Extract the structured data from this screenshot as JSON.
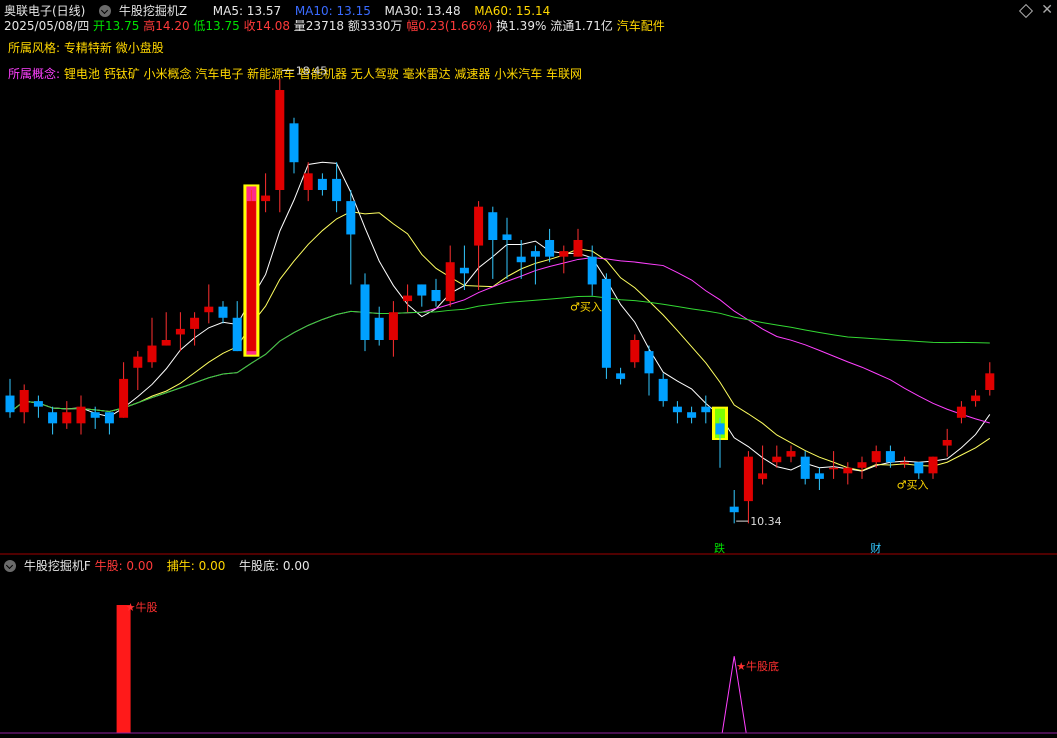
{
  "header": {
    "stock": "奥联电子(日线)",
    "indicator_main": "牛股挖掘机Z",
    "ma5": "MA5: 13.57",
    "ma10": "MA10: 13.15",
    "ma30": "MA30: 13.48",
    "ma60": "MA60: 15.14",
    "date": "2025/05/08/四",
    "open": "开13.75",
    "high": "高14.20",
    "low": "低13.75",
    "close": "收14.08",
    "volume": "量23718",
    "amount": "额3330万",
    "change": "幅0.23(1.66%)",
    "turnover": "换1.39%",
    "float": "流通1.71亿",
    "sector": "汽车配件"
  },
  "style": {
    "label": "所属风格:",
    "value": "专精特新 微小盘股"
  },
  "concept": {
    "label": "所属概念:",
    "value": "锂电池 钙钛矿 小米概念 汽车电子 新能源车 智能机器 无人驾驶 毫米雷达 减速器 小米汽车 车联网"
  },
  "sub_header": {
    "title": "牛股挖掘机F",
    "niugu": "牛股: 0.00",
    "boniu": "捕牛: 0.00",
    "niugudi": "牛股底: 0.00"
  },
  "colors": {
    "up": "#e00000",
    "down": "#00a0ff",
    "ma5": "#ffffff",
    "ma10": "#ffff60",
    "ma30": "#ff40ff",
    "ma60": "#33d833"
  },
  "chart_data": [
    {
      "type": "candlestick",
      "title": "奥联电子(日线)",
      "ylim": [
        10.0,
        19.0
      ],
      "candles": [
        [
          12.6,
          12.3,
          12.9,
          12.2
        ],
        [
          12.3,
          12.7,
          12.8,
          12.1
        ],
        [
          12.5,
          12.4,
          12.6,
          12.2
        ],
        [
          12.3,
          12.1,
          12.4,
          11.9
        ],
        [
          12.1,
          12.3,
          12.5,
          12.0
        ],
        [
          12.1,
          12.4,
          12.6,
          11.9
        ],
        [
          12.3,
          12.2,
          12.4,
          12.0
        ],
        [
          12.3,
          12.1,
          12.3,
          11.9
        ],
        [
          12.2,
          12.9,
          13.2,
          12.2
        ],
        [
          13.1,
          13.3,
          13.4,
          12.7
        ],
        [
          13.2,
          13.5,
          14.0,
          13.1
        ],
        [
          13.5,
          13.6,
          14.1,
          13.5
        ],
        [
          13.7,
          13.8,
          14.1,
          13.4
        ],
        [
          13.8,
          14.0,
          14.1,
          13.5
        ],
        [
          14.1,
          14.2,
          14.6,
          13.9
        ],
        [
          14.2,
          14.0,
          14.3,
          13.9
        ],
        [
          14.0,
          13.4,
          14.3,
          13.4
        ],
        [
          13.4,
          16.1,
          16.3,
          13.4
        ],
        [
          16.1,
          16.2,
          16.6,
          15.9
        ],
        [
          16.3,
          18.1,
          18.3,
          15.9
        ],
        [
          17.5,
          16.8,
          17.6,
          16.6
        ],
        [
          16.3,
          16.6,
          16.8,
          16.1
        ],
        [
          16.5,
          16.3,
          16.6,
          16.2
        ],
        [
          16.5,
          16.1,
          16.8,
          15.9
        ],
        [
          16.1,
          15.5,
          16.3,
          14.6
        ],
        [
          14.6,
          13.6,
          14.8,
          13.4
        ],
        [
          14.0,
          13.6,
          14.2,
          13.5
        ],
        [
          13.6,
          14.1,
          14.3,
          13.3
        ],
        [
          14.3,
          14.4,
          14.6,
          14.1
        ],
        [
          14.6,
          14.4,
          14.6,
          14.2
        ],
        [
          14.5,
          14.3,
          14.7,
          14.2
        ],
        [
          14.3,
          15.0,
          15.3,
          14.2
        ],
        [
          14.9,
          14.8,
          15.3,
          14.5
        ],
        [
          15.3,
          16.0,
          16.1,
          14.5
        ],
        [
          15.9,
          15.4,
          16.0,
          14.7
        ],
        [
          15.5,
          15.4,
          15.8,
          14.7
        ],
        [
          15.1,
          15.0,
          15.4,
          14.7
        ],
        [
          15.2,
          15.1,
          15.3,
          14.6
        ],
        [
          15.4,
          15.1,
          15.6,
          15.0
        ],
        [
          15.1,
          15.2,
          15.3,
          14.8
        ],
        [
          15.1,
          15.4,
          15.6,
          15.1
        ],
        [
          15.1,
          14.6,
          15.3,
          14.4
        ],
        [
          14.7,
          13.1,
          14.8,
          12.9
        ],
        [
          13.0,
          12.9,
          13.1,
          12.8
        ],
        [
          13.2,
          13.6,
          13.7,
          13.1
        ],
        [
          13.4,
          13.0,
          13.5,
          12.6
        ],
        [
          12.9,
          12.5,
          13.0,
          12.4
        ],
        [
          12.4,
          12.3,
          12.5,
          12.1
        ],
        [
          12.3,
          12.2,
          12.4,
          12.1
        ],
        [
          12.4,
          12.3,
          12.6,
          12.1
        ],
        [
          12.1,
          11.9,
          12.2,
          11.3
        ],
        [
          10.6,
          10.5,
          10.9,
          10.3
        ],
        [
          10.7,
          11.5,
          11.6,
          10.3
        ],
        [
          11.1,
          11.2,
          11.7,
          11.0
        ],
        [
          11.4,
          11.5,
          11.7,
          11.3
        ],
        [
          11.5,
          11.6,
          11.7,
          11.4
        ],
        [
          11.5,
          11.1,
          11.6,
          11.0
        ],
        [
          11.2,
          11.1,
          11.3,
          10.9
        ],
        [
          11.3,
          11.3,
          11.6,
          11.1
        ],
        [
          11.2,
          11.3,
          11.4,
          11.0
        ],
        [
          11.3,
          11.4,
          11.5,
          11.1
        ],
        [
          11.4,
          11.6,
          11.7,
          11.3
        ],
        [
          11.6,
          11.4,
          11.7,
          11.3
        ],
        [
          11.4,
          11.4,
          11.5,
          11.3
        ],
        [
          11.4,
          11.2,
          11.4,
          11.1
        ],
        [
          11.2,
          11.5,
          11.5,
          11.1
        ],
        [
          11.7,
          11.8,
          12.0,
          11.5
        ],
        [
          12.2,
          12.4,
          12.5,
          12.1
        ],
        [
          12.5,
          12.6,
          12.7,
          12.4
        ],
        [
          12.7,
          13.0,
          13.2,
          12.6
        ]
      ],
      "candle_fields": [
        "open",
        "close",
        "high",
        "low"
      ],
      "highlight_bars": [
        {
          "index": 17,
          "label": "magenta-yellow"
        },
        {
          "index": 50,
          "label": "green-yellow"
        }
      ],
      "annotations": [
        {
          "text": "18.45",
          "index": 19,
          "value": 18.45
        },
        {
          "text": "10.34",
          "index": 51,
          "value": 10.34
        },
        {
          "text": "买入",
          "index": 40,
          "value": 14.2
        },
        {
          "text": "买入",
          "index": 63,
          "value": 11.0
        }
      ],
      "bottom_markers": [
        {
          "text": "跌",
          "index": 50
        },
        {
          "text": "财",
          "index": 61
        }
      ]
    },
    {
      "type": "bar",
      "title": "牛股挖掘机F",
      "series": [
        {
          "name": "牛股",
          "values": [
            {
              "index": 8,
              "value": 1.0
            }
          ]
        },
        {
          "name": "牛股底",
          "values": [
            {
              "index": 51,
              "value": 0.6
            }
          ]
        }
      ],
      "annotations": [
        {
          "text": "牛股",
          "index": 8
        },
        {
          "text": "牛股底",
          "index": 51
        }
      ],
      "ylim": [
        0,
        1.0
      ]
    }
  ]
}
